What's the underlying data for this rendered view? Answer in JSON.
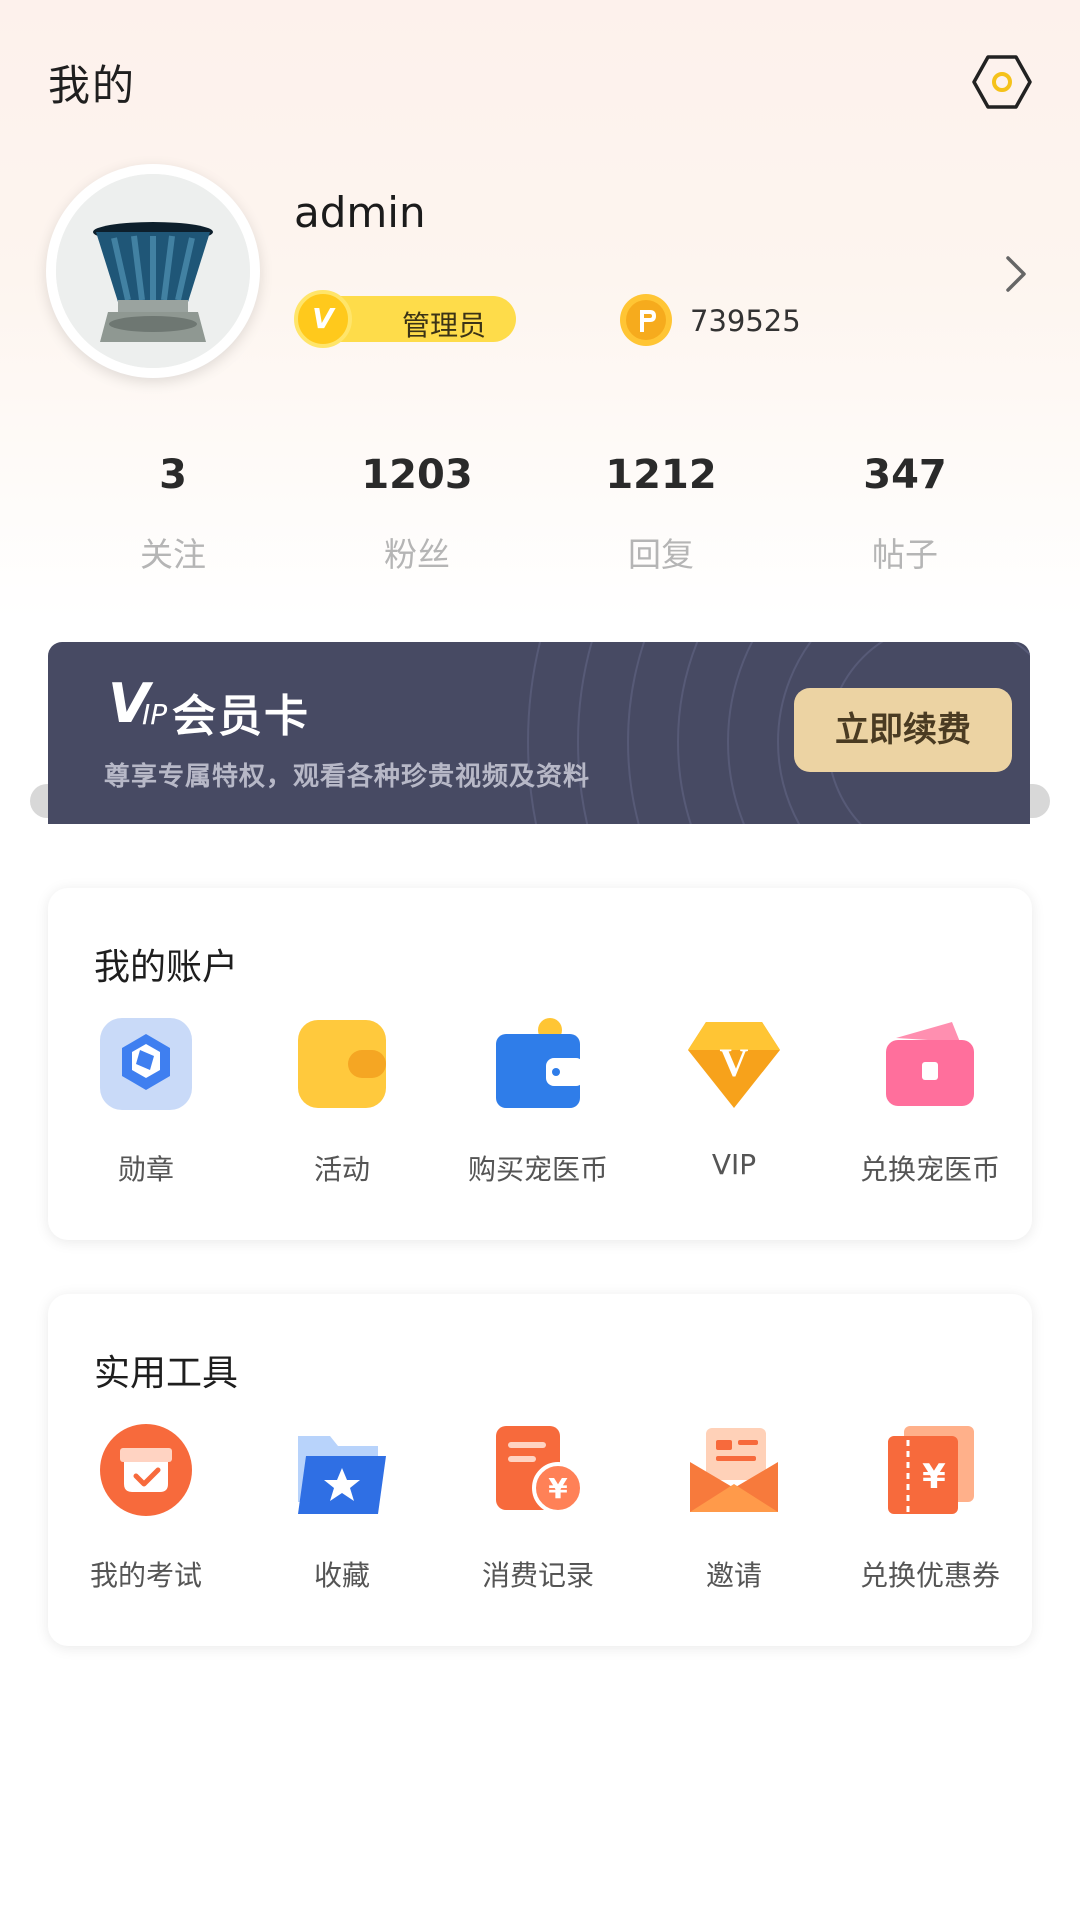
{
  "header": {
    "title": "我的",
    "settings_icon": "settings-hexagon-icon"
  },
  "profile": {
    "username": "admin",
    "role_label": "管理员",
    "role_badge_letter": "V",
    "coin_count": "739525",
    "coin_icon": "coin-icon"
  },
  "stats": [
    {
      "value": "3",
      "label": "关注"
    },
    {
      "value": "1203",
      "label": "粉丝"
    },
    {
      "value": "1212",
      "label": "回复"
    },
    {
      "value": "347",
      "label": "帖子"
    }
  ],
  "vip_banner": {
    "logo_text": "V",
    "logo_sub": "IP",
    "title": "会员卡",
    "subtitle": "尊享专属特权，观看各种珍贵视频及资料",
    "button_label": "立即续费"
  },
  "account_section": {
    "title": "我的账户",
    "items": [
      {
        "label": "勋章",
        "icon": "medal-icon"
      },
      {
        "label": "活动",
        "icon": "wallet-activity-icon"
      },
      {
        "label": "购买宠医币",
        "icon": "wallet-coin-icon"
      },
      {
        "label": "VIP",
        "icon": "vip-diamond-icon"
      },
      {
        "label": "兑换宠医币",
        "icon": "exchange-wallet-icon"
      }
    ]
  },
  "tools_section": {
    "title": "实用工具",
    "items": [
      {
        "label": "我的考试",
        "icon": "exam-icon"
      },
      {
        "label": "收藏",
        "icon": "favorite-folder-icon"
      },
      {
        "label": "消费记录",
        "icon": "consumption-record-icon"
      },
      {
        "label": "邀请",
        "icon": "invite-envelope-icon"
      },
      {
        "label": "兑换优惠券",
        "icon": "coupon-icon"
      }
    ]
  },
  "colors": {
    "vip_card_bg": "#474a63",
    "vip_button_bg": "#ecd3a3",
    "role_badge_bg": "#fedc4a",
    "accent_orange": "#f76a3c",
    "accent_blue": "#2f7de9"
  }
}
